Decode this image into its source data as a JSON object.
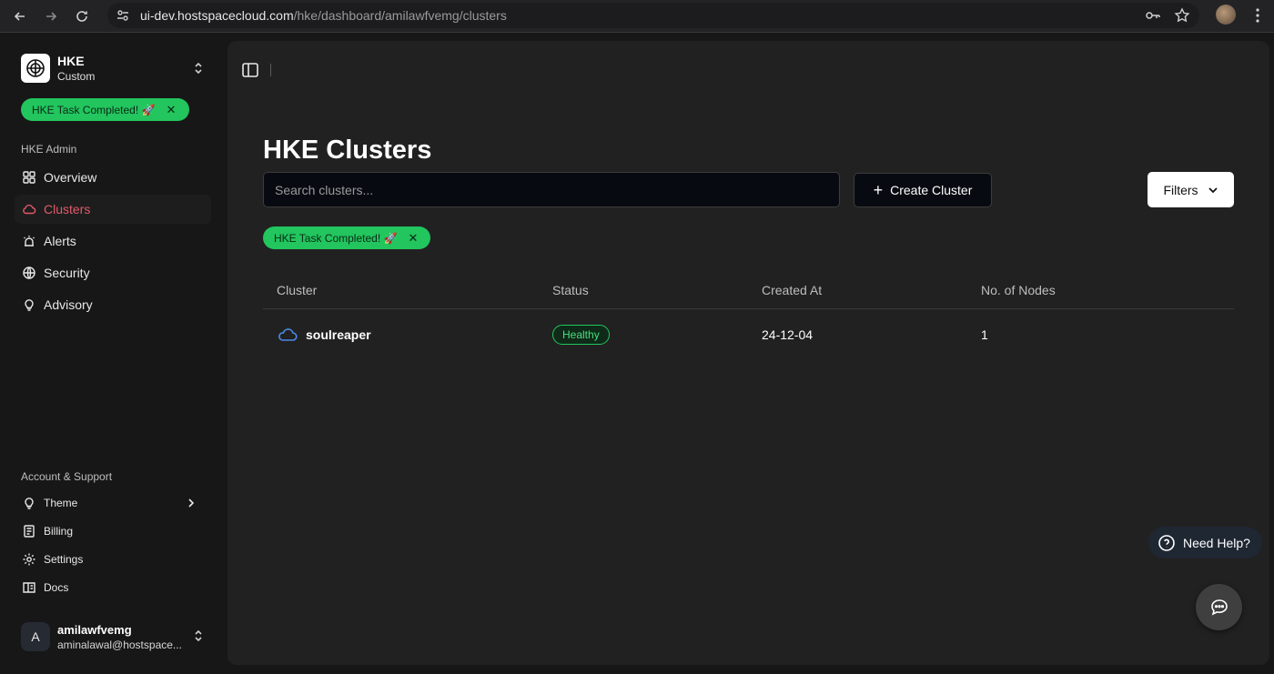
{
  "browser": {
    "url_host": "ui-dev.hostspacecloud.com",
    "url_path": "/hke/dashboard/amilawfvemg/clusters"
  },
  "sidebar": {
    "brand_title": "HKE",
    "brand_subtitle": "Custom",
    "toast": "HKE Task Completed! 🚀",
    "admin_section": "HKE Admin",
    "nav": [
      {
        "label": "Overview",
        "icon": "grid-icon",
        "active": false
      },
      {
        "label": "Clusters",
        "icon": "cloud-icon",
        "active": true
      },
      {
        "label": "Alerts",
        "icon": "siren-icon",
        "active": false
      },
      {
        "label": "Security",
        "icon": "globe-lock-icon",
        "active": false
      },
      {
        "label": "Advisory",
        "icon": "lightbulb-icon",
        "active": false
      }
    ],
    "account_section": "Account & Support",
    "account_nav": [
      {
        "label": "Theme",
        "icon": "lightbulb-icon"
      },
      {
        "label": "Billing",
        "icon": "receipt-icon"
      },
      {
        "label": "Settings",
        "icon": "gear-icon"
      },
      {
        "label": "Docs",
        "icon": "book-icon"
      }
    ],
    "user": {
      "initial": "A",
      "name": "amilawfvemg",
      "email": "aminalawal@hostspace..."
    }
  },
  "main": {
    "title": "HKE Clusters",
    "search_placeholder": "Search clusters...",
    "create_label": "Create Cluster",
    "filters_label": "Filters",
    "toast": "HKE Task Completed! 🚀",
    "table": {
      "columns": [
        "Cluster",
        "Status",
        "Created At",
        "No. of Nodes"
      ],
      "rows": [
        {
          "cluster": "soulreaper",
          "status": "Healthy",
          "created_at": "24-12-04",
          "nodes": "1"
        }
      ]
    }
  },
  "help": {
    "label": "Need Help?"
  },
  "colors": {
    "accent_active": "#e05a6a",
    "success": "#22c55e",
    "background": "#171717",
    "panel": "#212121"
  }
}
